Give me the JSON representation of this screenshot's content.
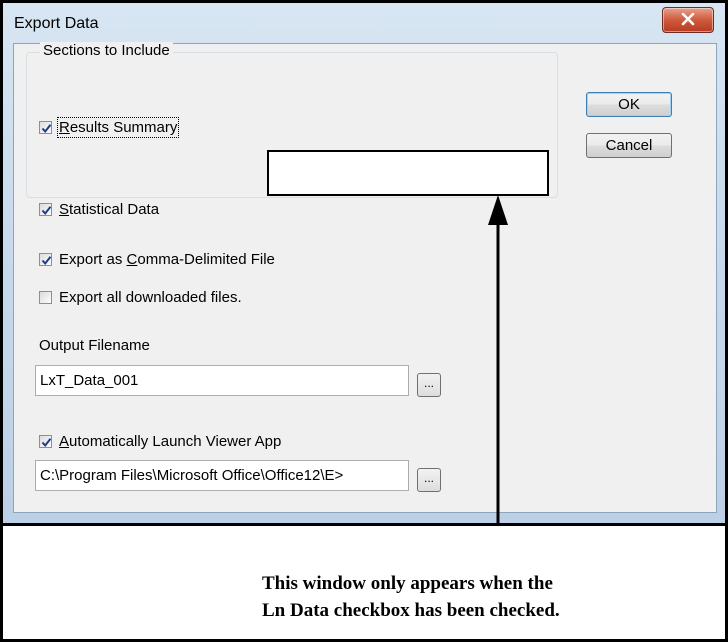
{
  "dialog": {
    "title": "Export Data",
    "close_icon": "close-x-icon",
    "ok_label": "OK",
    "cancel_label": "Cancel",
    "sections": {
      "group_label": "Sections to Include",
      "results_summary": {
        "label": "Results Summary",
        "mnemonic": "R",
        "rest": "esults Summary",
        "checked": true
      },
      "statistical_data": {
        "label": "Statistical Data",
        "mnemonic": "S",
        "rest": "tatistical Data",
        "checked": true
      }
    },
    "export_csv": {
      "prefix": "Export as ",
      "mnemonic": "C",
      "rest": "omma-Delimited File",
      "checked": true
    },
    "export_all": {
      "label": "Export all downloaded files.",
      "checked": false
    },
    "output_filename": {
      "label": "Output Filename",
      "value": "LxT_Data_001",
      "browse_label": "..."
    },
    "auto_launch": {
      "mnemonic": "A",
      "rest": "utomatically Launch Viewer App",
      "checked": true
    },
    "viewer_path": {
      "value": "C:\\Program Files\\Microsoft Office\\Office12\\E>",
      "browse_label": "..."
    }
  },
  "annotation": {
    "line1": "This window only appears when the",
    "line2": "Ln Data checkbox has been checked."
  },
  "colors": {
    "checkmark": "#1c3e8a",
    "close_button": "#c9472b"
  }
}
